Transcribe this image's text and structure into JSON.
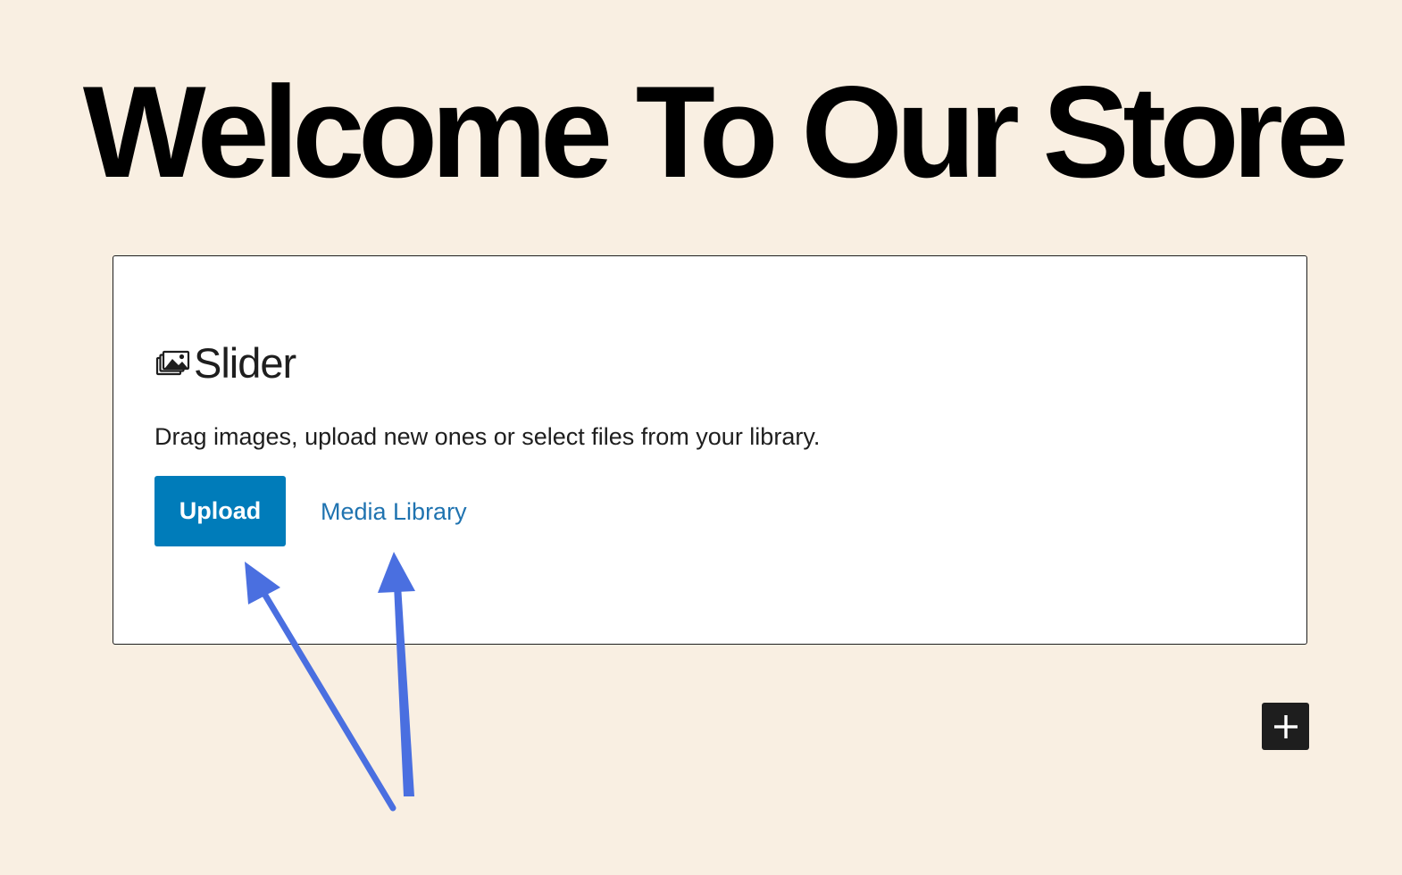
{
  "page": {
    "title": "Welcome To Our Store"
  },
  "slider_block": {
    "icon": "gallery-icon",
    "title": "Slider",
    "instructions": "Drag images, upload new ones or select files from your library.",
    "upload_label": "Upload",
    "media_library_label": "Media Library"
  },
  "toolbar": {
    "add_block_icon": "plus-icon"
  },
  "annotations": {
    "arrow_color": "#4a6fe0"
  },
  "colors": {
    "background": "#f9efe2",
    "primary_button": "#007cba",
    "link": "#1f73b0",
    "text": "#1e1e1e"
  }
}
